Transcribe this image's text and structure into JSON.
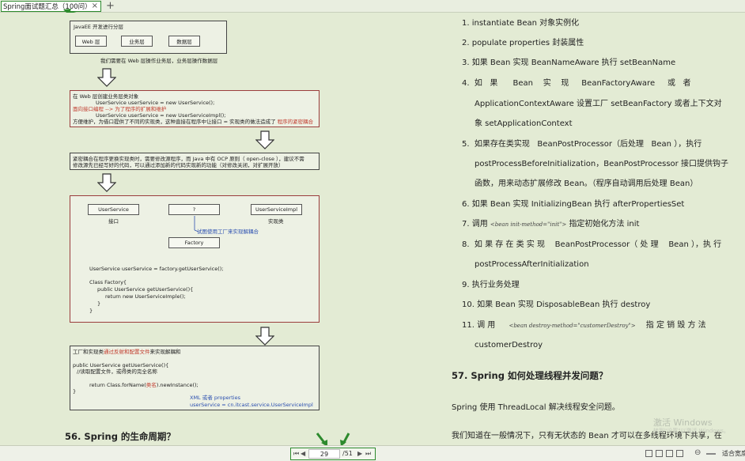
{
  "tab": {
    "title": "Spring面试题汇总（100问）",
    "close": "×",
    "add": "+"
  },
  "diagram": {
    "box1_title": "JavaEE 开发进行分层",
    "layers": [
      "Web 层",
      "业务层",
      "数据层"
    ],
    "note1": "我们需要在 Web 层操作业务层，业务层操作数据层",
    "box2": {
      "l1": "在 Web 层创建业务层类对象",
      "l2": "UserService userService = new UserService();",
      "l3": "面向接口编程 --> 为了程序的扩展和维护",
      "l4": "UserService userService = new UserServiceImpl();",
      "l5a": "方便维护，为借口提供了不同的实现类，这种直接在程序中让接口 = 实现类的做法造成了",
      "l5b": "程序的紧密耦合"
    },
    "box3": {
      "l1": "紧密耦合在程序更换实现类时，需要修改源程序，而 Java 中有 OCP 原则（ open-close ），建议不需",
      "l2": "修改源先已经写好的代码，可以通过添加新的代码实现新的功能（对修改关闭，对扩展开放）"
    },
    "box4": {
      "userservice": "UserService",
      "question": "?",
      "impl": "UserServiceImpl",
      "iface": "接口",
      "implcls": "实现类",
      "factory_note": "试图使用工厂来实现解耦合",
      "factory": "Factory",
      "code1": "UserService userService = factory.getUserService();",
      "code2": "Class Factory{",
      "code3": "public UserService getUserService(){",
      "code4": "return new UserServiceImple();",
      "code5": "}",
      "code6": "}"
    },
    "box5": {
      "l1a": "工厂和实现类",
      "l1b": "通过反射和配置文件",
      "l1c": "来实现解耦和",
      "l2": "public UserService getUserService(){",
      "l3": "//读取配置文件，或得类的完全名称",
      "l4a": "return Class.forName(",
      "l4b": "类名",
      "l4c": ").newInstance();",
      "l5": "}",
      "xml1": "XML 或者 properties",
      "xml2": "userService = cn.itcast.service.UserServiceImpl"
    }
  },
  "left_heading": "56. Spring  的生命周期？",
  "lifecycle": {
    "i1": "1.  instantiate Bean  对象实例化",
    "i2": "2.  populate properties  封装属性",
    "i3": "3.  如果  Bean  实现  BeanNameAware  执行  setBeanName",
    "i4a": "4.  如   果      Bean    实    现     BeanFactoryAware     或   者",
    "i4b": "ApplicationContextAware  设置工厂  setBeanFactory  或者上下文对",
    "i4c": "象  setApplicationContext",
    "i5a": "5.  如果存在类实现   BeanPostProcessor（后处理   Bean ），执行",
    "i5b": "postProcessBeforeInitialization，BeanPostProcessor  接口提供钩子",
    "i5c": "函数，用来动态扩展修改  Bean。（程序自动调用后处理  Bean）",
    "i6": "6.  如果  Bean  实现  InitializingBean  执行  afterPropertiesSet",
    "i7a": "7.  调用",
    "i7code": "<bean init-method=\"init\">",
    "i7b": "指定初始化方法  init",
    "i8a": "8.  如 果 存 在 类 实 现    BeanPostProcessor（ 处 理    Bean ），执 行",
    "i8b": "postProcessAfterInitialization",
    "i9": "9.  执行业务处理",
    "i10": "10.  如果  Bean  实现  DisposableBean  执行  destroy",
    "i11a": "11.  调 用",
    "i11code": "<bean   destroy-method=\"customerDestroy\">",
    "i11b": "指 定 销 毁 方 法",
    "i11c": "customerDestroy"
  },
  "right_heading": "57. Spring  如何处理线程并发问题？",
  "para1": "Spring  使用  ThreadLocal  解决线程安全问题。",
  "para2": "我们知道在一般情况下，只有无状态的  Bean  才可以在多线程环境下共享，在",
  "watermark": "激活 Windows",
  "watermark_sub": "转到\"设置\"以激活 Windows。",
  "nav": {
    "current_page": "29",
    "total": "/51"
  },
  "zoom": {
    "minus": "⊖",
    "fit": "适合宽度"
  }
}
